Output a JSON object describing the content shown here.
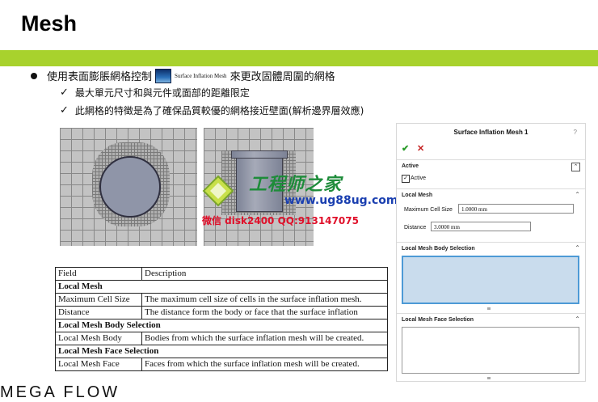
{
  "slide": {
    "title": "Mesh",
    "bullet_main_pre": "使用表面膨脹網格控制",
    "bullet_icon": "surface-inflation-mesh-icon",
    "bullet_icon_label": "Surface Inflation Mesh",
    "bullet_main_post": "來更改固體周圍的網格",
    "sub_bullets": [
      "最大單元尺寸和與元件或面部的距離限定",
      "此網格的特徵是為了確保品質較優的網格接近壁面(解析邊界層效應)"
    ],
    "bottom_partial_text": "MEGA FLOW"
  },
  "watermark": {
    "title": "工程师之家",
    "url": "www.ug88ug.com",
    "contact": "微信 disk2400 QQ:913147075"
  },
  "table": {
    "header": [
      "Field",
      "Description"
    ],
    "rows": [
      {
        "type": "section",
        "field": "Local Mesh",
        "description": ""
      },
      {
        "type": "row",
        "field": "Maximum Cell Size",
        "description": "The maximum cell size of cells in the surface inflation mesh."
      },
      {
        "type": "row",
        "field": "Distance",
        "description": "The distance form the body or face that the surface inflation"
      },
      {
        "type": "section",
        "field": "Local Mesh Body Selection",
        "description": ""
      },
      {
        "type": "row",
        "field": "Local Mesh Body",
        "description": "Bodies from which the surface inflation mesh will be created."
      },
      {
        "type": "section",
        "field": "Local Mesh Face Selection",
        "description": ""
      },
      {
        "type": "row",
        "field": "Local Mesh Face",
        "description": "Faces from which the surface inflation mesh will be created."
      }
    ]
  },
  "panel": {
    "title": "Surface Inflation Mesh 1",
    "help": "?",
    "ok_icon": "checkmark-icon",
    "cancel_icon": "close-icon",
    "active_section": "Active",
    "active_checkbox_label": "Active",
    "active_checked": true,
    "local_mesh_section": "Local Mesh",
    "max_cell_label": "Maximum Cell Size",
    "max_cell_value": "1.0000 mm",
    "distance_label": "Distance",
    "distance_value": "3.0000 mm",
    "body_selection_section": "Local Mesh Body Selection",
    "face_selection_section": "Local Mesh Face Selection",
    "colors": {
      "accent_green": "#a8d22d",
      "selection_fill": "#c9dced",
      "selection_border": "#4d9ad6"
    }
  }
}
